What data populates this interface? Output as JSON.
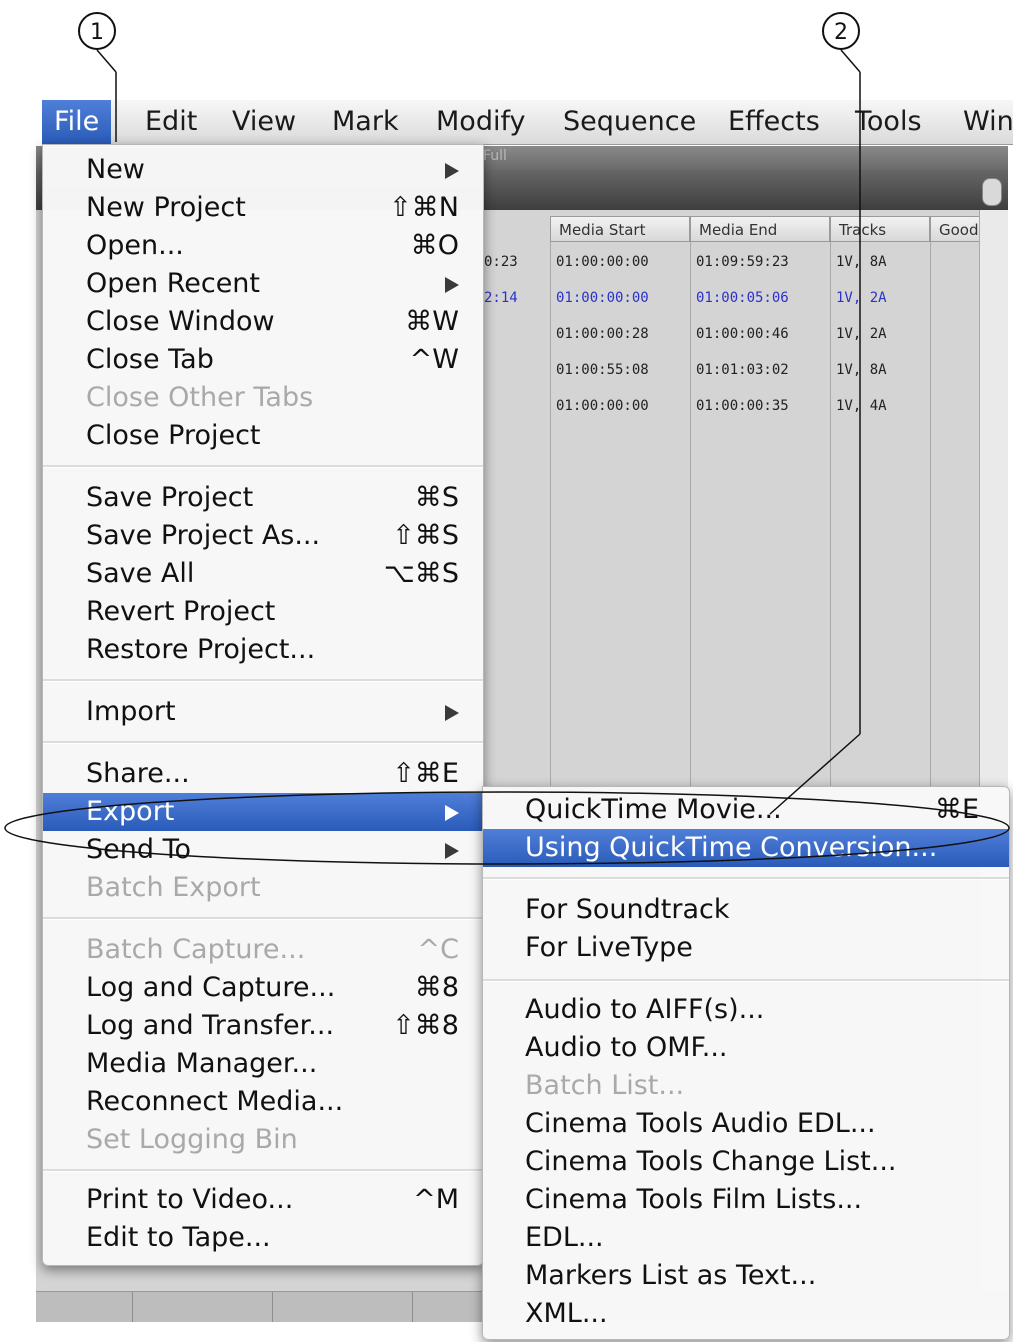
{
  "callouts": [
    "1",
    "2"
  ],
  "menubar": {
    "items": [
      "File",
      "Edit",
      "View",
      "Mark",
      "Modify",
      "Sequence",
      "Effects",
      "Tools",
      "Win"
    ]
  },
  "background": {
    "toolbar_text": "Full",
    "columns": [
      "Media Start",
      "Media End",
      "Tracks",
      "Good"
    ],
    "rows": [
      {
        "dur": "0:23",
        "start": "01:00:00:00",
        "end": "01:09:59:23",
        "tracks": "1V, 8A",
        "selected": false
      },
      {
        "dur": "2:14",
        "start": "01:00:00:00",
        "end": "01:00:05:06",
        "tracks": "1V, 2A",
        "selected": true
      },
      {
        "dur": "",
        "start": "01:00:00:28",
        "end": "01:00:00:46",
        "tracks": "1V, 2A",
        "selected": false
      },
      {
        "dur": "",
        "start": "01:00:55:08",
        "end": "01:01:03:02",
        "tracks": "1V, 8A",
        "selected": false
      },
      {
        "dur": "",
        "start": "01:00:00:00",
        "end": "01:00:00:35",
        "tracks": "1V, 4A",
        "selected": false
      }
    ]
  },
  "file_menu": {
    "items": [
      {
        "label": "New",
        "shortcut": "",
        "submenu": true,
        "disabled": false
      },
      {
        "label": "New Project",
        "shortcut": "⇧⌘N",
        "submenu": false,
        "disabled": false
      },
      {
        "label": "Open...",
        "shortcut": "⌘O",
        "submenu": false,
        "disabled": false
      },
      {
        "label": "Open Recent",
        "shortcut": "",
        "submenu": true,
        "disabled": false
      },
      {
        "label": "Close Window",
        "shortcut": "⌘W",
        "submenu": false,
        "disabled": false
      },
      {
        "label": "Close Tab",
        "shortcut": "^W",
        "submenu": false,
        "disabled": false
      },
      {
        "label": "Close Other Tabs",
        "shortcut": "",
        "submenu": false,
        "disabled": true
      },
      {
        "label": "Close Project",
        "shortcut": "",
        "submenu": false,
        "disabled": false
      },
      {
        "label": "Save Project",
        "shortcut": "⌘S",
        "submenu": false,
        "disabled": false
      },
      {
        "label": "Save Project As...",
        "shortcut": "⇧⌘S",
        "submenu": false,
        "disabled": false
      },
      {
        "label": "Save All",
        "shortcut": "⌥⌘S",
        "submenu": false,
        "disabled": false
      },
      {
        "label": "Revert Project",
        "shortcut": "",
        "submenu": false,
        "disabled": false
      },
      {
        "label": "Restore Project...",
        "shortcut": "",
        "submenu": false,
        "disabled": false
      },
      {
        "label": "Import",
        "shortcut": "",
        "submenu": true,
        "disabled": false
      },
      {
        "label": "Share...",
        "shortcut": "⇧⌘E",
        "submenu": false,
        "disabled": false
      },
      {
        "label": "Export",
        "shortcut": "",
        "submenu": true,
        "disabled": false,
        "highlighted": true
      },
      {
        "label": "Send To",
        "shortcut": "",
        "submenu": true,
        "disabled": false
      },
      {
        "label": "Batch Export",
        "shortcut": "",
        "submenu": false,
        "disabled": true
      },
      {
        "label": "Batch Capture...",
        "shortcut": "^C",
        "submenu": false,
        "disabled": true
      },
      {
        "label": "Log and Capture...",
        "shortcut": "⌘8",
        "submenu": false,
        "disabled": false
      },
      {
        "label": "Log and Transfer...",
        "shortcut": "⇧⌘8",
        "submenu": false,
        "disabled": false
      },
      {
        "label": "Media Manager...",
        "shortcut": "",
        "submenu": false,
        "disabled": false
      },
      {
        "label": "Reconnect Media...",
        "shortcut": "",
        "submenu": false,
        "disabled": false
      },
      {
        "label": "Set Logging Bin",
        "shortcut": "",
        "submenu": false,
        "disabled": true
      },
      {
        "label": "Print to Video...",
        "shortcut": "^M",
        "submenu": false,
        "disabled": false
      },
      {
        "label": "Edit to Tape...",
        "shortcut": "",
        "submenu": false,
        "disabled": false
      }
    ]
  },
  "export_menu": {
    "items": [
      {
        "label": "QuickTime Movie...",
        "shortcut": "⌘E",
        "disabled": false
      },
      {
        "label": "Using QuickTime Conversion...",
        "shortcut": "",
        "disabled": false,
        "highlighted": true
      },
      {
        "label": "For Soundtrack",
        "shortcut": "",
        "disabled": false
      },
      {
        "label": "For LiveType",
        "shortcut": "",
        "disabled": false
      },
      {
        "label": "Audio to AIFF(s)...",
        "shortcut": "",
        "disabled": false
      },
      {
        "label": "Audio to OMF...",
        "shortcut": "",
        "disabled": false
      },
      {
        "label": "Batch List...",
        "shortcut": "",
        "disabled": true
      },
      {
        "label": "Cinema Tools Audio EDL...",
        "shortcut": "",
        "disabled": false
      },
      {
        "label": "Cinema Tools Change List...",
        "shortcut": "",
        "disabled": false
      },
      {
        "label": "Cinema Tools Film Lists...",
        "shortcut": "",
        "disabled": false
      },
      {
        "label": "EDL...",
        "shortcut": "",
        "disabled": false
      },
      {
        "label": "Markers List as Text...",
        "shortcut": "",
        "disabled": false
      },
      {
        "label": "XML...",
        "shortcut": "",
        "disabled": false
      }
    ]
  }
}
